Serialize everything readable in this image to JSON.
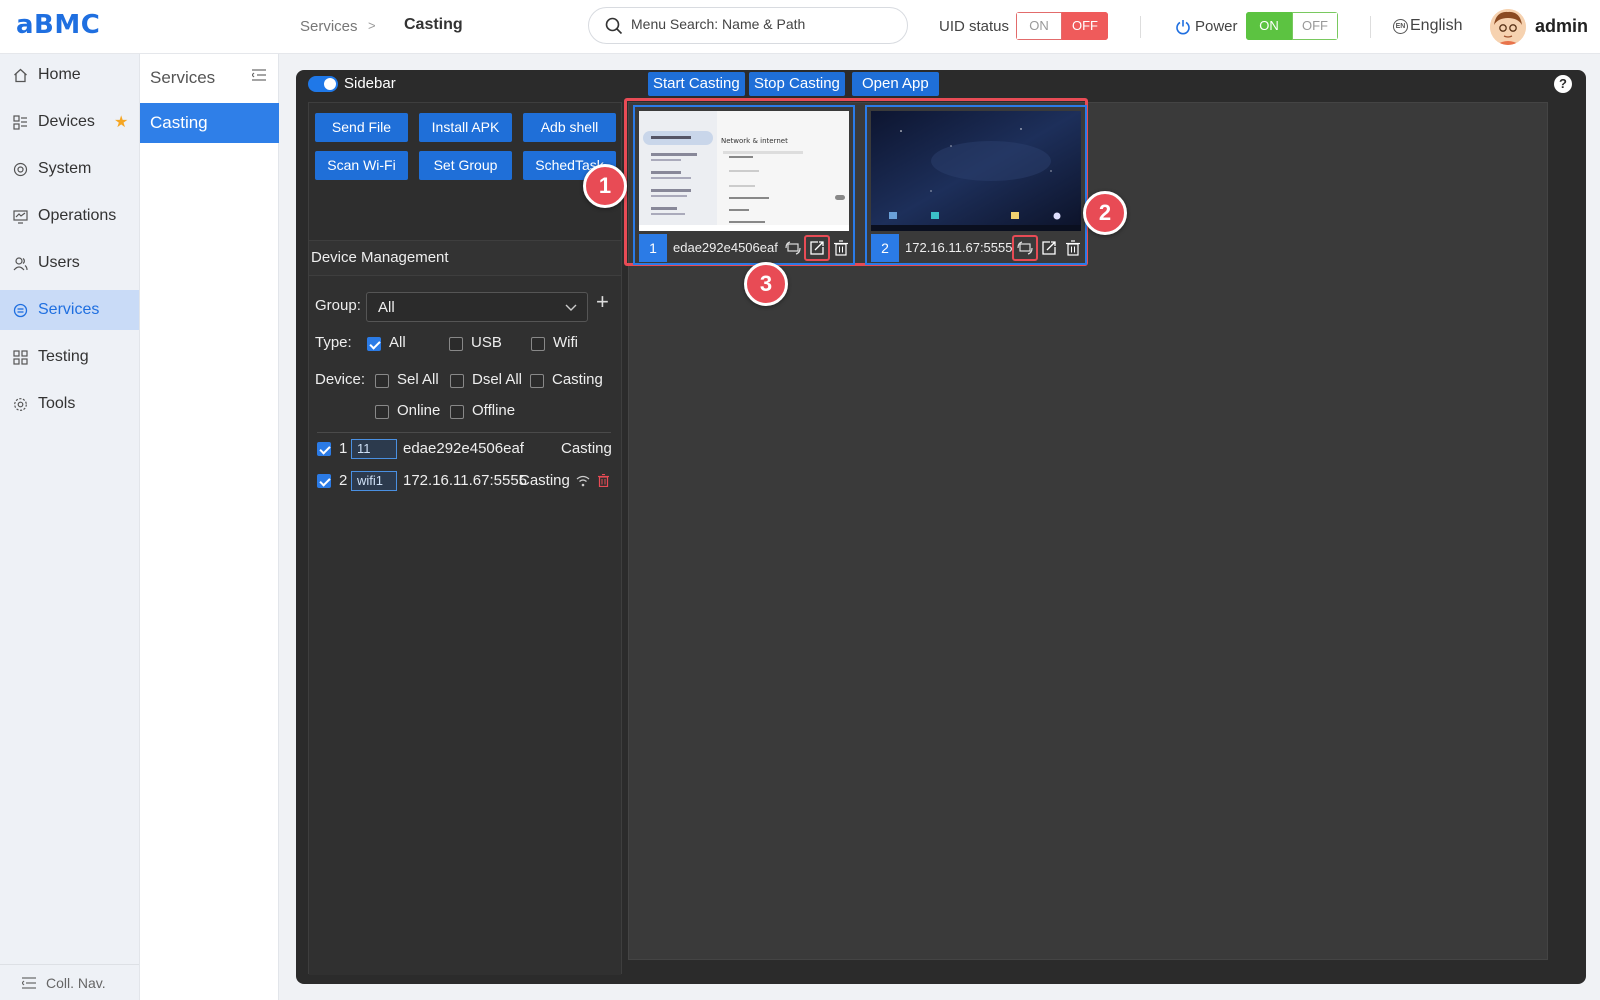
{
  "header": {
    "logo": "aBMC",
    "breadcrumb_parent": "Services",
    "breadcrumb_sep": ">",
    "breadcrumb_current": "Casting",
    "search_placeholder": "Menu Search: Name & Path",
    "uid_label": "UID status",
    "uid_on": "ON",
    "uid_off": "OFF",
    "power_label": "Power",
    "power_on": "ON",
    "power_off": "OFF",
    "language": "English",
    "language_icon": "EN",
    "user": "admin"
  },
  "nav": {
    "items": [
      {
        "label": "Home",
        "icon": "home-icon"
      },
      {
        "label": "Devices",
        "icon": "devices-icon"
      },
      {
        "label": "System",
        "icon": "system-icon"
      },
      {
        "label": "Operations",
        "icon": "operations-icon"
      },
      {
        "label": "Users",
        "icon": "users-icon"
      },
      {
        "label": "Services",
        "icon": "services-icon"
      },
      {
        "label": "Testing",
        "icon": "testing-icon"
      },
      {
        "label": "Tools",
        "icon": "tools-icon"
      }
    ],
    "active": "Services",
    "collapse_label": "Coll. Nav."
  },
  "subnav": {
    "title": "Services",
    "item": "Casting"
  },
  "toolbar": {
    "sidebar_label": "Sidebar",
    "start_casting": "Start Casting",
    "stop_casting": "Stop Casting",
    "open_app": "Open App",
    "help": "?"
  },
  "actions": {
    "send_file": "Send File",
    "install_apk": "Install APK",
    "adb_shell": "Adb shell",
    "scan_wifi": "Scan Wi-Fi",
    "set_group": "Set Group",
    "sched_task": "SchedTask"
  },
  "device_mgmt": {
    "title": "Device Management",
    "group_label": "Group:",
    "group_value": "All",
    "type_label": "Type:",
    "type_all": "All",
    "type_usb": "USB",
    "type_wifi": "Wifi",
    "device_label": "Device:",
    "sel_all": "Sel All",
    "dsel_all": "Dsel All",
    "casting": "Casting",
    "online": "Online",
    "offline": "Offline",
    "devices": [
      {
        "num": "1",
        "tag": "11",
        "id": "edae292e4506eaf",
        "status": "Casting"
      },
      {
        "num": "2",
        "tag": "wifi1",
        "id": "172.16.11.67:5555",
        "status": "Casting"
      }
    ]
  },
  "cards": [
    {
      "num": "1",
      "id": "edae292e4506eaf",
      "screen_title": "Network & internet"
    },
    {
      "num": "2",
      "id": "172.16.11.67:5555"
    }
  ],
  "badges": [
    "1",
    "2",
    "3"
  ],
  "colors": {
    "accent": "#1f6fe0",
    "highlight": "#e84b55",
    "on_green": "#5cc341",
    "off_red": "#ef5b5b"
  }
}
